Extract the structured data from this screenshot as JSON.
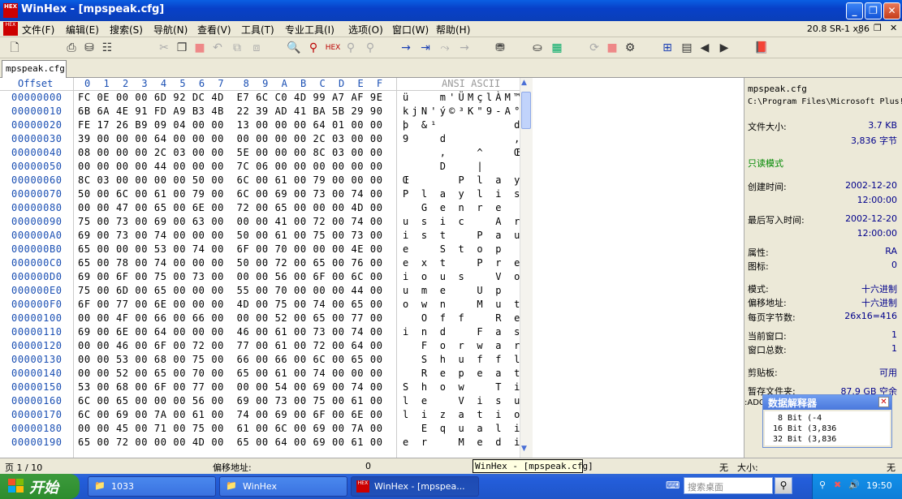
{
  "window": {
    "title": "WinHex - [mpspeak.cfg]",
    "icon_text": "HEX"
  },
  "menu": [
    "文件(F)",
    "编辑(E)",
    "搜索(S)",
    "导航(N)",
    "查看(V)",
    "工具(T)",
    "专业工具(I)",
    "选项(O)",
    "窗口(W)",
    "帮助(H)"
  ],
  "version": "20.8 SR-1 x86",
  "tab": {
    "label": "mpspeak.cfg"
  },
  "hex_header": {
    "offset": "Offset",
    "cols": "0  1  2  3  4  5  6  7   8  9  A  B  C  D  E  F",
    "ansi": "ANSI ASCII"
  },
  "rows": [
    {
      "off": "00000000",
      "hex": "FC 0E 00 00 6D 92 DC 4D  E7 6C C0 4D 99 A7 AF 9E",
      "asc": "ü   m'ÜMçlÀM™§¯ž"
    },
    {
      "off": "00000010",
      "hex": "6B 6A 4E 91 FD A9 B3 4B  22 39 AD 41 BA 5B 29 90",
      "asc": "kjN'ý©³K\"9-A°[)□"
    },
    {
      "off": "00000020",
      "hex": "FE 17 26 B9 09 04 00 00  13 00 00 00 64 01 00 00",
      "asc": "þ &¹        d"
    },
    {
      "off": "00000030",
      "hex": "39 00 00 00 64 00 00 00  00 00 00 00 2C 03 00 00",
      "asc": "9   d       ,"
    },
    {
      "off": "00000040",
      "hex": "08 00 00 00 2C 03 00 00  5E 00 00 00 8C 03 00 00",
      "asc": "    ,   ^   Œ"
    },
    {
      "off": "00000050",
      "hex": "00 00 00 00 44 00 00 00  7C 06 00 00 00 00 00 00",
      "asc": "    D   |"
    },
    {
      "off": "00000060",
      "hex": "8C 03 00 00 00 00 50 00  6C 00 61 00 79 00 00 00",
      "asc": "Œ     P l a y"
    },
    {
      "off": "00000070",
      "hex": "50 00 6C 00 61 00 79 00  6C 00 69 00 73 00 74 00",
      "asc": "P l a y l i s t"
    },
    {
      "off": "00000080",
      "hex": "00 00 47 00 65 00 6E 00  72 00 65 00 00 00 4D 00",
      "asc": "  G e n r e   M"
    },
    {
      "off": "00000090",
      "hex": "75 00 73 00 69 00 63 00  00 00 41 00 72 00 74 00",
      "asc": "u s i c   A r t"
    },
    {
      "off": "000000A0",
      "hex": "69 00 73 00 74 00 00 00  50 00 61 00 75 00 73 00",
      "asc": "i s t   P a u s"
    },
    {
      "off": "000000B0",
      "hex": "65 00 00 00 53 00 74 00  6F 00 70 00 00 00 4E 00",
      "asc": "e   S t o p   N"
    },
    {
      "off": "000000C0",
      "hex": "65 00 78 00 74 00 00 00  50 00 72 00 65 00 76 00",
      "asc": "e x t   P r e v"
    },
    {
      "off": "000000D0",
      "hex": "69 00 6F 00 75 00 73 00  00 00 56 00 6F 00 6C 00",
      "asc": "i o u s   V o l"
    },
    {
      "off": "000000E0",
      "hex": "75 00 6D 00 65 00 00 00  55 00 70 00 00 00 44 00",
      "asc": "u m e   U p   D"
    },
    {
      "off": "000000F0",
      "hex": "6F 00 77 00 6E 00 00 00  4D 00 75 00 74 00 65 00",
      "asc": "o w n   M u t e"
    },
    {
      "off": "00000100",
      "hex": "00 00 4F 00 66 00 66 00  00 00 52 00 65 00 77 00",
      "asc": "  O f f   R e w"
    },
    {
      "off": "00000110",
      "hex": "69 00 6E 00 64 00 00 00  46 00 61 00 73 00 74 00",
      "asc": "i n d   F a s t"
    },
    {
      "off": "00000120",
      "hex": "00 00 46 00 6F 00 72 00  77 00 61 00 72 00 64 00",
      "asc": "  F o r w a r d"
    },
    {
      "off": "00000130",
      "hex": "00 00 53 00 68 00 75 00  66 00 66 00 6C 00 65 00",
      "asc": "  S h u f f l e"
    },
    {
      "off": "00000140",
      "hex": "00 00 52 00 65 00 70 00  65 00 61 00 74 00 00 00",
      "asc": "  R e p e a t"
    },
    {
      "off": "00000150",
      "hex": "53 00 68 00 6F 00 77 00  00 00 54 00 69 00 74 00",
      "asc": "S h o w   T i t"
    },
    {
      "off": "00000160",
      "hex": "6C 00 65 00 00 00 56 00  69 00 73 00 75 00 61 00",
      "asc": "l e   V i s u a"
    },
    {
      "off": "00000170",
      "hex": "6C 00 69 00 7A 00 61 00  74 00 69 00 6F 00 6E 00",
      "asc": "l i z a t i o n"
    },
    {
      "off": "00000180",
      "hex": "00 00 45 00 71 00 75 00  61 00 6C 00 69 00 7A 00",
      "asc": "  E q u a l i z"
    },
    {
      "off": "00000190",
      "hex": "65 00 72 00 00 00 4D 00  65 00 64 00 69 00 61 00",
      "asc": "e r   M e d i a"
    }
  ],
  "info": {
    "filename": "mpspeak.cfg",
    "path": "C:\\Program Files\\Microsoft Plus!",
    "size_label": "文件大小:",
    "size_kb": "3.7 KB",
    "size_bytes": "3,836 字节",
    "readonly": "只读模式",
    "created_label": "创建时间:",
    "created_date": "2002-12-20",
    "created_time": "12:00:00",
    "modified_label": "最后写入时间:",
    "modified_date": "2002-12-20",
    "modified_time": "12:00:00",
    "attr_label": "属性:",
    "attr": "RA",
    "icon_label": "图标:",
    "icon": "0",
    "mode_label": "模式:",
    "mode": "十六进制",
    "offset_label": "偏移地址:",
    "offset": "十六进制",
    "bpp_label": "每页字节数:",
    "bpp": "26x16=416",
    "curwin_label": "当前窗口:",
    "curwin": "1",
    "totwin_label": "窗口总数:",
    "totwin": "1",
    "clip_label": "剪贴板:",
    "clip": "可用",
    "temp_label": "暂存文件夹:",
    "temp": "87.9 GB 空余",
    "temp_path": ":ADOCU"
  },
  "interpreter": {
    "title": "数据解释器",
    "lines": [
      "8 Bit (-4",
      "16 Bit (3,836",
      "32 Bit (3,836"
    ]
  },
  "status": {
    "page": "页 1 / 10",
    "offset_label": "偏移地址:",
    "offset": "0",
    "none": "无",
    "size_label": "大小:",
    "size": "无"
  },
  "tooltip": "WinHex - [mpspeak.cfg]",
  "taskbar": {
    "start": "开始",
    "tasks": [
      "1033",
      "WinHex",
      "WinHex - [mpspea..."
    ],
    "search": "搜索桌面",
    "clock": "19:50"
  }
}
